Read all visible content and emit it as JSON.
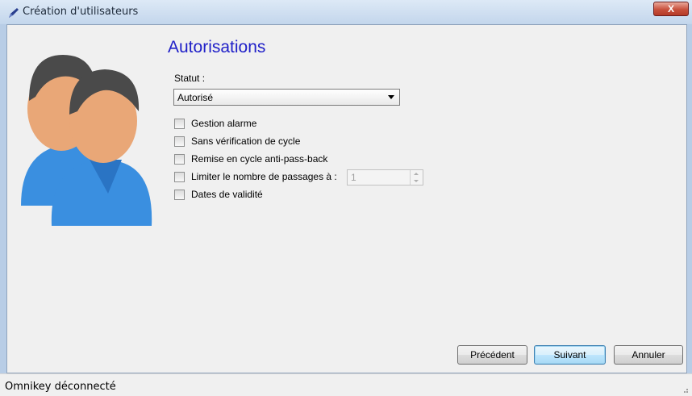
{
  "window": {
    "title": "Création d'utilisateurs",
    "close_label": "X"
  },
  "page": {
    "heading": "Autorisations"
  },
  "statut": {
    "label": "Statut :",
    "selected": "Autorisé"
  },
  "options": [
    {
      "label": "Gestion alarme",
      "checked": false
    },
    {
      "label": "Sans vérification de cycle",
      "checked": false
    },
    {
      "label": "Remise en cycle anti-pass-back",
      "checked": false
    },
    {
      "label": "Limiter le nombre de passages à :",
      "checked": false
    },
    {
      "label": "Dates de validité",
      "checked": false
    }
  ],
  "passages": {
    "value": "1"
  },
  "buttons": {
    "previous": "Précédent",
    "next": "Suivant",
    "cancel": "Annuler"
  },
  "status": {
    "text": "Omnikey déconnecté"
  },
  "colors": {
    "heading": "#2020c8",
    "shirt": "#3a8fe0",
    "skin": "#e9a777",
    "hair": "#4a4a4a"
  }
}
